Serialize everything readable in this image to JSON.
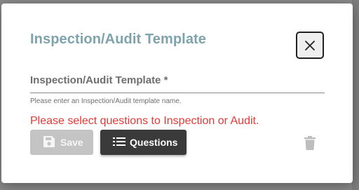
{
  "dialog": {
    "title": "Inspection/Audit Template",
    "close_icon": "close-icon"
  },
  "form": {
    "name_label": "Inspection/Audit Template *",
    "name_value": "",
    "name_helper": "Please enter an Inspection/Audit template name.",
    "error_message": "Please select questions to Inspection or Audit."
  },
  "actions": {
    "save_label": "Save",
    "save_icon": "save-icon",
    "save_disabled": true,
    "questions_label": "Questions",
    "questions_icon": "list-icon",
    "delete_icon": "trash-icon"
  },
  "colors": {
    "title": "#7fa3ad",
    "error": "#e53935",
    "primary_button": "#3a3a3a",
    "disabled_button": "#c4c4c4"
  }
}
